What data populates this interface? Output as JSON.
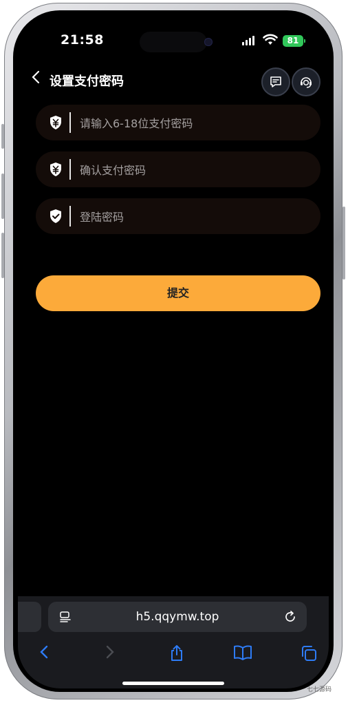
{
  "status": {
    "time": "21:58",
    "battery": "81"
  },
  "header": {
    "title": "设置支付密码"
  },
  "form": {
    "pay_password_placeholder": "请输入6-18位支付密码",
    "confirm_password_placeholder": "确认支付密码",
    "login_password_placeholder": "登陆密码",
    "submit_label": "提交"
  },
  "browser": {
    "url": "h5.qqymw.top"
  },
  "colors": {
    "accent": "#fcaa3a",
    "field_bg": "#140c09",
    "battery": "#31c75a"
  },
  "watermark": "七七源码"
}
